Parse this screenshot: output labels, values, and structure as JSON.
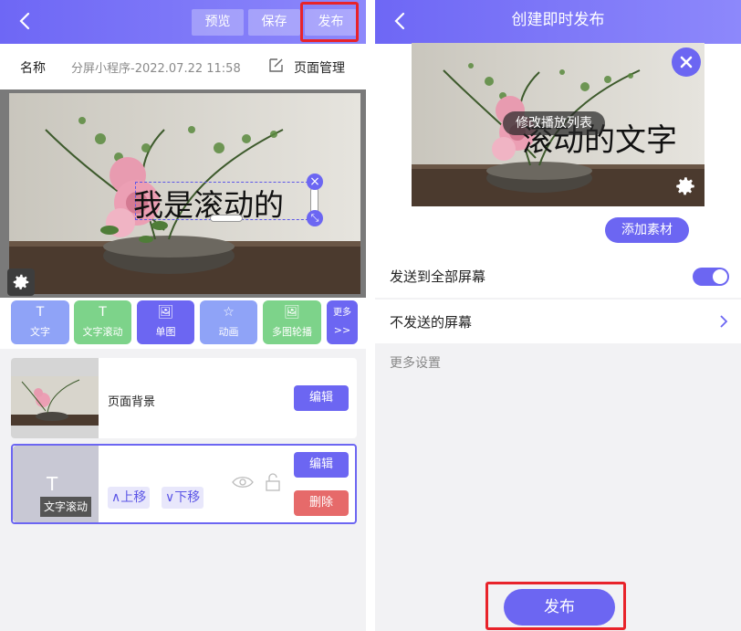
{
  "left": {
    "header": {
      "preview_label": "预览",
      "save_label": "保存",
      "publish_label": "发布"
    },
    "namebar": {
      "name_label": "名称",
      "name_value": "分屏小程序-2022.07.22 11:58",
      "page_manage_label": "页面管理"
    },
    "canvas": {
      "scroll_text": "我是滚动的"
    },
    "tools": [
      {
        "icon": "T",
        "label": "文字",
        "color": "#8fa3f7"
      },
      {
        "icon": "T",
        "label": "文字滚动",
        "color": "#7dd38a"
      },
      {
        "icon": "🖼",
        "label": "单图",
        "color": "#6c66f2"
      },
      {
        "icon": "☆",
        "label": "动画",
        "color": "#8fa3f7"
      },
      {
        "icon": "🖼",
        "label": "多图轮播",
        "color": "#7dd38a"
      },
      {
        "icon": "更多",
        "label": ">>",
        "color": "#6c66f2"
      }
    ],
    "layers": [
      {
        "name": "页面背景",
        "edit_label": "编辑"
      },
      {
        "thumb_icon": "T",
        "thumb_label": "文字滚动",
        "up_label": "上移",
        "down_label": "下移",
        "edit_label": "编辑",
        "delete_label": "删除"
      }
    ]
  },
  "right": {
    "header": {
      "title": "创建即时发布"
    },
    "preview": {
      "text": "滚动的文字",
      "tip": "修改播放列表"
    },
    "add_material_label": "添加素材",
    "send_all": {
      "label": "发送到全部屏幕",
      "enabled": true
    },
    "exclude": {
      "label": "不发送的屏幕"
    },
    "more_settings_label": "更多设置",
    "publish_label": "发布"
  }
}
